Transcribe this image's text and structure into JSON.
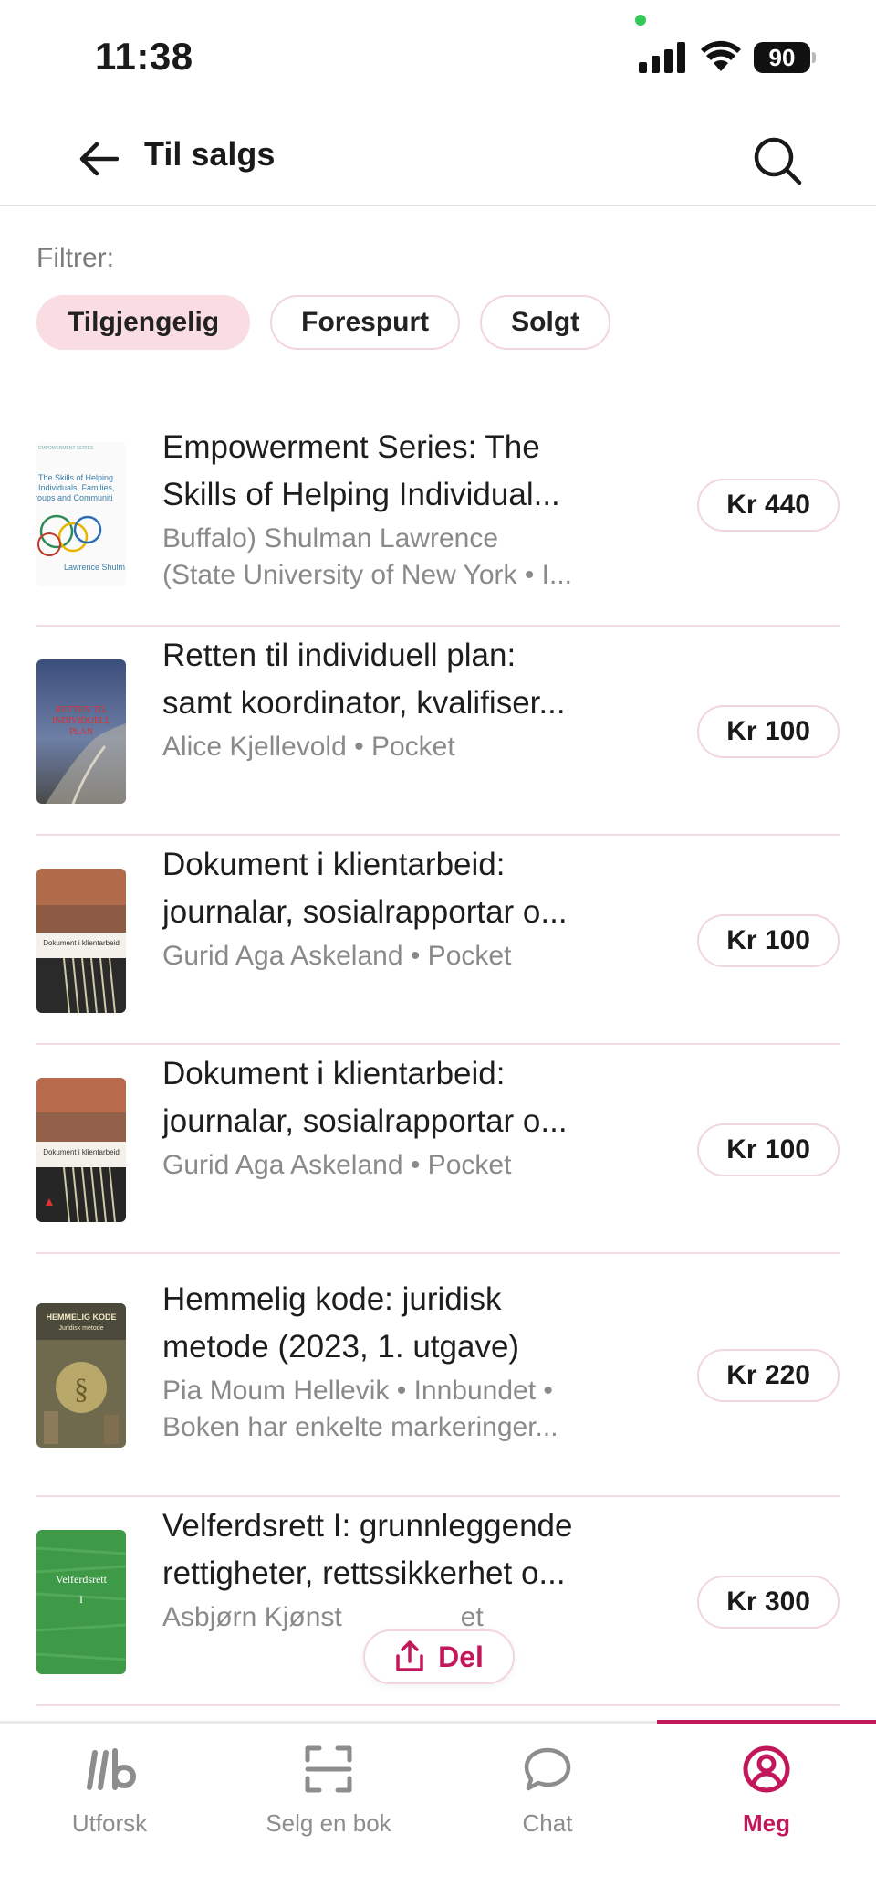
{
  "status_bar": {
    "time": "11:38",
    "battery": "90"
  },
  "header": {
    "title": "Til salgs"
  },
  "filter": {
    "label": "Filtrer:",
    "chips": [
      "Tilgjengelig",
      "Forespurt",
      "Solgt"
    ],
    "active": "Tilgjengelig"
  },
  "listings": [
    {
      "title_line1": "Empowerment Series: The",
      "title_line2": "Skills of Helping Individual...",
      "meta_line1": "Buffalo) Shulman Lawrence",
      "meta_line2": "(State University of New York • I...",
      "price": "Kr 440",
      "cover_text": [
        "The Skills of Helping",
        "Individuals, Families,",
        "roups and Communiti",
        "Lawrence Shulm"
      ]
    },
    {
      "title_line1": "Retten til individuell plan:",
      "title_line2": "samt koordinator, kvalifiser...",
      "meta_line1": "Alice Kjellevold • Pocket",
      "meta_line2": "",
      "price": "Kr 100",
      "cover_text": [
        "RETTEN TIL",
        "INDIVIDUELL",
        "PLAN"
      ]
    },
    {
      "title_line1": "Dokument i klientarbeid:",
      "title_line2": "journalar, sosialrapportar o...",
      "meta_line1": "Gurid Aga Askeland • Pocket",
      "meta_line2": "",
      "price": "Kr 100",
      "cover_text": [
        "Dokument i klientarbeid"
      ]
    },
    {
      "title_line1": "Dokument i klientarbeid:",
      "title_line2": "journalar, sosialrapportar o...",
      "meta_line1": "Gurid Aga Askeland • Pocket",
      "meta_line2": "",
      "price": "Kr 100",
      "cover_text": [
        "Dokument i klientarbeid"
      ]
    },
    {
      "title_line1": "Hemmelig kode: juridisk",
      "title_line2": "metode (2023, 1. utgave)",
      "meta_line1": "Pia Moum Hellevik • Innbundet •",
      "meta_line2": "Boken har enkelte markeringer...",
      "price": "Kr 220",
      "cover_text": [
        "HEMMELIG KODE",
        "Juridisk metode"
      ]
    },
    {
      "title_line1": "Velferdsrett I: grunnleggende",
      "title_line2": "rettigheter, rettssikkerhet o...",
      "meta_line1": "Asbjørn Kjønst",
      "meta_line2": "",
      "meta_tail": "et",
      "price": "Kr 300",
      "cover_text": [
        "Velferdsrett",
        "I"
      ]
    }
  ],
  "share": {
    "label": "Del"
  },
  "bottom_nav": {
    "items": [
      {
        "label": "Utforsk",
        "icon": "library-logo-icon"
      },
      {
        "label": "Selg en bok",
        "icon": "scan-icon"
      },
      {
        "label": "Chat",
        "icon": "chat-bubble-icon"
      },
      {
        "label": "Meg",
        "icon": "profile-icon"
      }
    ],
    "active": "Meg"
  },
  "colors": {
    "accent": "#c2185b",
    "chip_active": "#fadde3",
    "divider": "#f2dde2"
  }
}
